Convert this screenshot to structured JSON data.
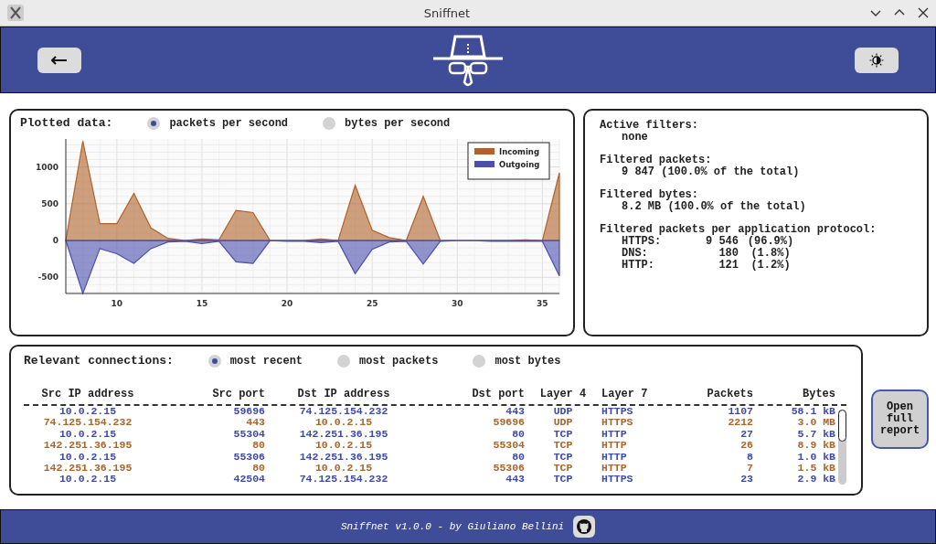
{
  "window": {
    "title": "Sniffnet"
  },
  "plot": {
    "title": "Plotted data:",
    "options": [
      {
        "label": "packets per second",
        "selected": true
      },
      {
        "label": "bytes per second",
        "selected": false
      }
    ],
    "chart_data": {
      "type": "area",
      "x": [
        7,
        8,
        9,
        10,
        11,
        12,
        13,
        14,
        15,
        16,
        17,
        18,
        19,
        20,
        21,
        22,
        23,
        24,
        25,
        26,
        27,
        28,
        29,
        30,
        31,
        32,
        33,
        34,
        35,
        36
      ],
      "xlim": [
        7,
        36
      ],
      "ylim": [
        -720,
        1380
      ],
      "xticks": [
        10,
        15,
        20,
        25,
        30,
        35
      ],
      "yticks": [
        -500,
        0,
        500,
        1000
      ],
      "grid": true,
      "legend": true,
      "series": [
        {
          "name": "Incoming",
          "color": "#b0622a",
          "values": [
            0,
            1350,
            230,
            230,
            640,
            170,
            30,
            0,
            20,
            10,
            410,
            380,
            0,
            0,
            0,
            20,
            0,
            750,
            140,
            40,
            0,
            600,
            0,
            0,
            0,
            0,
            0,
            10,
            0,
            920
          ]
        },
        {
          "name": "Outgoing",
          "color": "#4a4fae",
          "values": [
            0,
            -720,
            -110,
            -180,
            -310,
            -110,
            -20,
            -10,
            -40,
            -10,
            -290,
            -310,
            0,
            -10,
            -10,
            -30,
            -10,
            -450,
            -120,
            -20,
            -10,
            -320,
            -10,
            0,
            0,
            -10,
            -10,
            -10,
            -10,
            -480
          ]
        }
      ]
    }
  },
  "stats": [
    {
      "heading": "Active filters:",
      "lines": [
        "none"
      ]
    },
    {
      "heading": "Filtered packets:",
      "lines": [
        "9 847 (100.0% of the total)"
      ]
    },
    {
      "heading": "Filtered bytes:",
      "lines": [
        "8.2 MB (100.0% of the total)"
      ]
    },
    {
      "heading": "Filtered packets per application protocol:",
      "protocols": [
        [
          "HTTPS:",
          "9 546",
          "(96.9%)"
        ],
        [
          "DNS:",
          "180",
          "(1.8%)"
        ],
        [
          "HTTP:",
          "121",
          "(1.2%)"
        ]
      ]
    }
  ],
  "connections": {
    "title": "Relevant connections:",
    "options": [
      {
        "label": "most recent",
        "selected": true
      },
      {
        "label": "most packets",
        "selected": false
      },
      {
        "label": "most bytes",
        "selected": false
      }
    ],
    "columns": [
      "Src IP address",
      "Src port",
      "Dst IP address",
      "Dst port",
      "Layer 4",
      "Layer 7",
      "Packets",
      "Bytes"
    ],
    "rows": [
      {
        "color": "#3d4aa6",
        "cells": [
          "10.0.2.15",
          "59696",
          "74.125.154.232",
          "443",
          "UDP",
          "HTTPS",
          "1107",
          "58.1 kB"
        ]
      },
      {
        "color": "#a8652c",
        "cells": [
          "74.125.154.232",
          "443",
          "10.0.2.15",
          "59696",
          "UDP",
          "HTTPS",
          "2212",
          "3.0 MB"
        ]
      },
      {
        "color": "#3d4aa6",
        "cells": [
          "10.0.2.15",
          "55304",
          "142.251.36.195",
          "80",
          "TCP",
          "HTTP",
          "27",
          "5.7 kB"
        ]
      },
      {
        "color": "#a8652c",
        "cells": [
          "142.251.36.195",
          "80",
          "10.0.2.15",
          "55304",
          "TCP",
          "HTTP",
          "26",
          "8.9 kB"
        ]
      },
      {
        "color": "#3d4aa6",
        "cells": [
          "10.0.2.15",
          "55306",
          "142.251.36.195",
          "80",
          "TCP",
          "HTTP",
          "8",
          "1.0 kB"
        ]
      },
      {
        "color": "#a8652c",
        "cells": [
          "142.251.36.195",
          "80",
          "10.0.2.15",
          "55306",
          "TCP",
          "HTTP",
          "7",
          "1.5 kB"
        ]
      },
      {
        "color": "#3d4aa6",
        "cells": [
          "10.0.2.15",
          "42504",
          "74.125.154.232",
          "443",
          "TCP",
          "HTTPS",
          "23",
          "2.9 kB"
        ]
      }
    ]
  },
  "report_button": "Open full report",
  "footer": "Sniffnet v1.0.0 - by Giuliano Bellini"
}
